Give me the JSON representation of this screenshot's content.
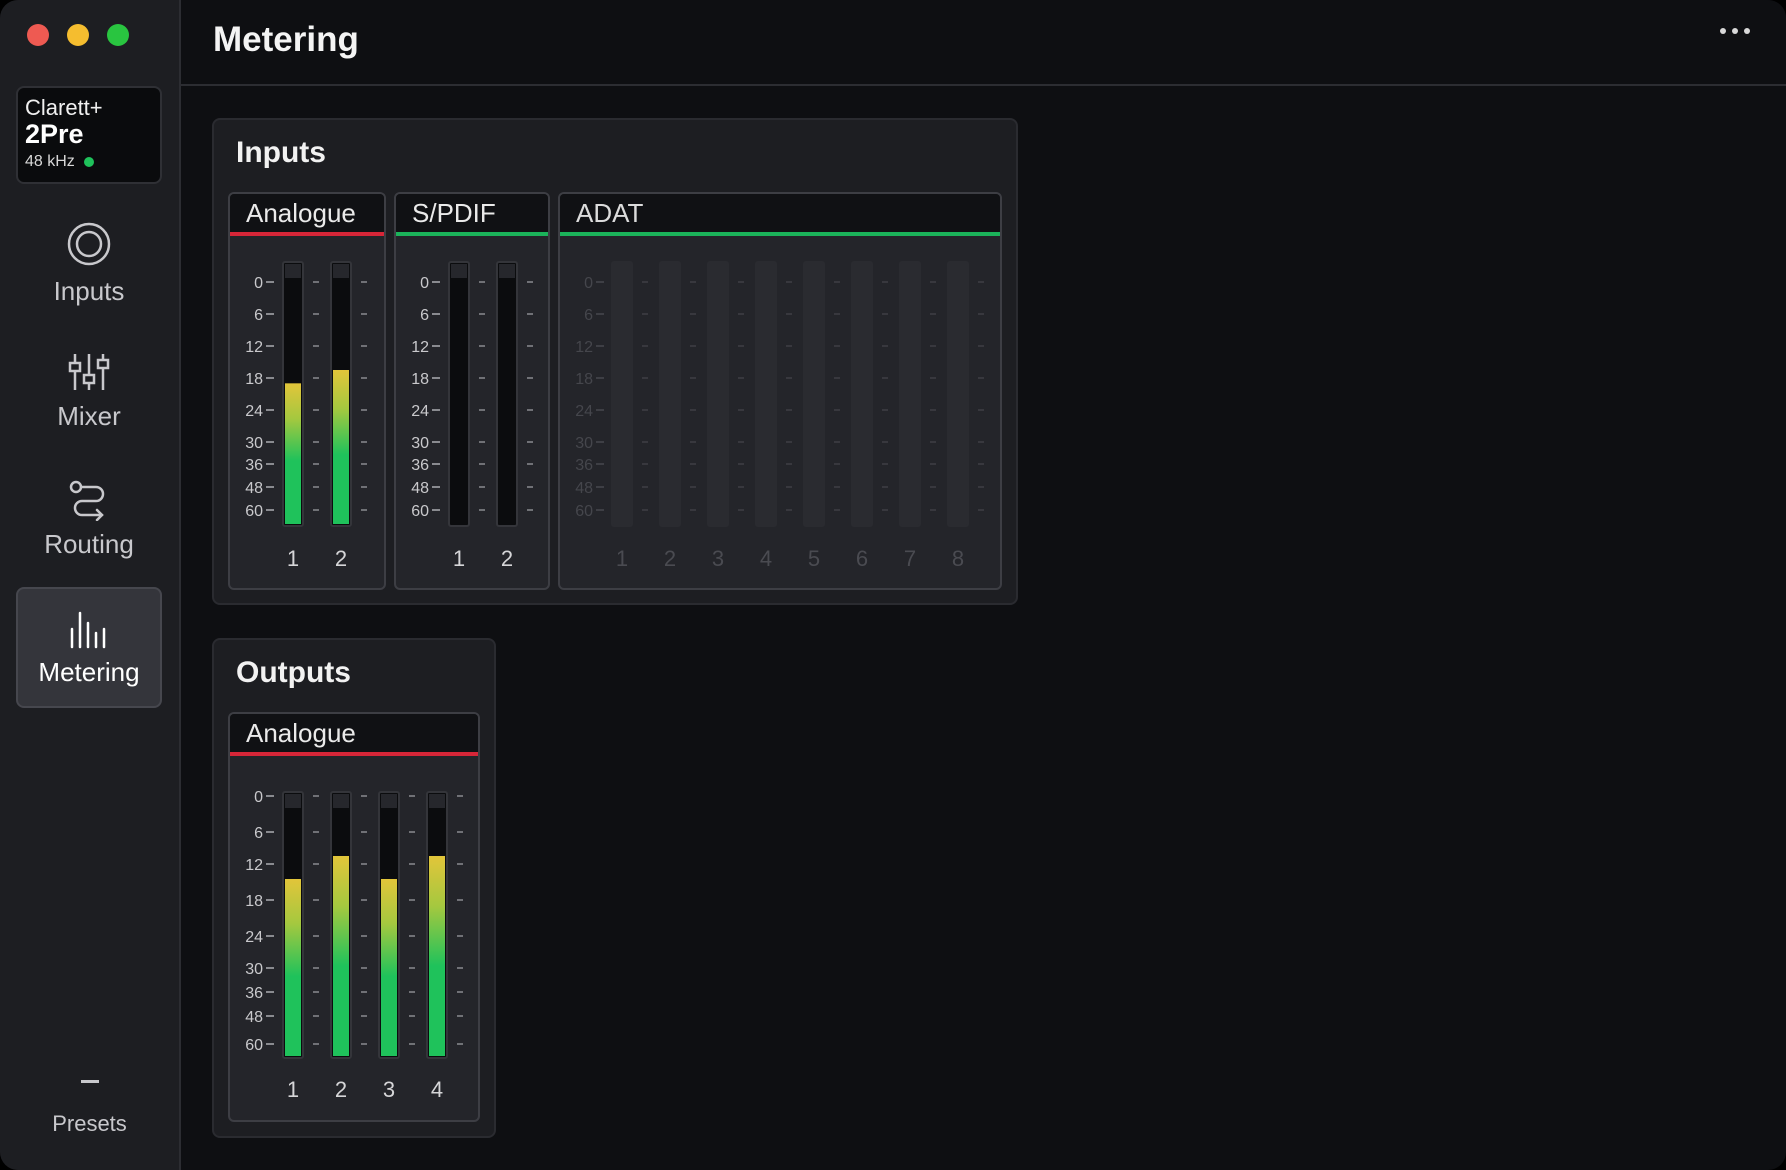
{
  "window": {
    "title": "Metering",
    "more_icon": "ellipsis-icon"
  },
  "device": {
    "brand": "Clarett+",
    "model": "2Pre",
    "sample_rate": "48 kHz",
    "status_color": "#1fc25b"
  },
  "nav": [
    {
      "label": "Inputs",
      "icon": "inputs-circle-icon",
      "active": false
    },
    {
      "label": "Mixer",
      "icon": "mixer-sliders-icon",
      "active": false
    },
    {
      "label": "Routing",
      "icon": "routing-icon",
      "active": false
    },
    {
      "label": "Metering",
      "icon": "metering-bars-icon",
      "active": true
    }
  ],
  "presets": {
    "label": "Presets"
  },
  "scale_labels": [
    "0",
    "6",
    "12",
    "18",
    "24",
    "30",
    "36",
    "48",
    "60"
  ],
  "colors": {
    "analogue_accent": "#d72638",
    "digital_accent": "#1bb35a",
    "meter_green": "#1fc25b",
    "meter_yellow": "#e2c53a"
  },
  "inputs": {
    "title": "Inputs",
    "groups": [
      {
        "name": "Analogue",
        "accent": "red",
        "dim": false,
        "channels": [
          {
            "label": "1",
            "level_db": 19
          },
          {
            "label": "2",
            "level_db": 16.5
          }
        ]
      },
      {
        "name": "S/PDIF",
        "accent": "green",
        "dim": false,
        "channels": [
          {
            "label": "1",
            "level_db": null
          },
          {
            "label": "2",
            "level_db": null
          }
        ]
      },
      {
        "name": "ADAT",
        "accent": "green",
        "dim": true,
        "channels": [
          {
            "label": "1",
            "level_db": null
          },
          {
            "label": "2",
            "level_db": null
          },
          {
            "label": "3",
            "level_db": null
          },
          {
            "label": "4",
            "level_db": null
          },
          {
            "label": "5",
            "level_db": null
          },
          {
            "label": "6",
            "level_db": null
          },
          {
            "label": "7",
            "level_db": null
          },
          {
            "label": "8",
            "level_db": null
          }
        ]
      }
    ]
  },
  "outputs": {
    "title": "Outputs",
    "groups": [
      {
        "name": "Analogue",
        "accent": "red",
        "dim": false,
        "channels": [
          {
            "label": "1",
            "level_db": 14.5
          },
          {
            "label": "2",
            "level_db": 10.5
          },
          {
            "label": "3",
            "level_db": 14.5
          },
          {
            "label": "4",
            "level_db": 10.5
          }
        ]
      }
    ]
  }
}
